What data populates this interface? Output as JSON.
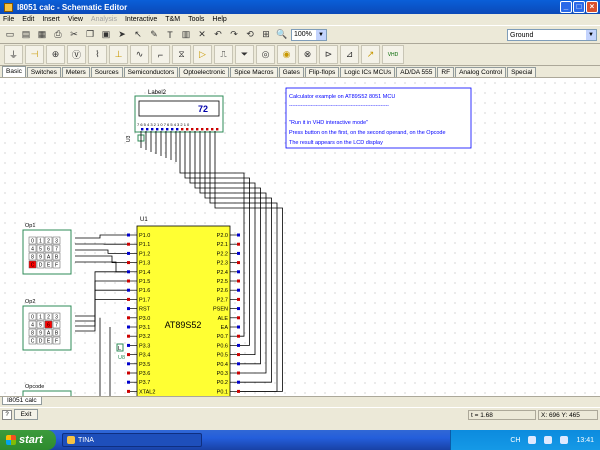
{
  "window": {
    "title": "I8051 calc - Schematic Editor",
    "minimize": "_",
    "maximize": "□",
    "close": "×"
  },
  "menu": [
    {
      "label": "File",
      "enabled": true
    },
    {
      "label": "Edit",
      "enabled": true
    },
    {
      "label": "Insert",
      "enabled": true
    },
    {
      "label": "View",
      "enabled": true
    },
    {
      "label": "Analysis",
      "enabled": false
    },
    {
      "label": "Interactive",
      "enabled": true
    },
    {
      "label": "T&M",
      "enabled": true
    },
    {
      "label": "Tools",
      "enabled": true
    },
    {
      "label": "Help",
      "enabled": true
    }
  ],
  "toolbar": {
    "zoom": "100%",
    "ground_select": "Ground",
    "dd_glyph": "▼"
  },
  "toolbar_icons": [
    "new-icon",
    "open-icon",
    "save-icon",
    "print-icon",
    "cut-icon",
    "copy-icon",
    "paste-icon",
    "pointer-icon",
    "arrow-icon",
    "pencil-icon",
    "text-icon",
    "bus-icon",
    "delete-icon",
    "undo-icon",
    "redo-icon",
    "rotate-icon",
    "grid-icon",
    "zoom-icon"
  ],
  "toolbar_icon_glyphs": [
    "▭",
    "▤",
    "▦",
    "⎙",
    "✂",
    "❐",
    "▣",
    "➤",
    "↖",
    "✎",
    "T",
    "▥",
    "✕",
    "↶",
    "↷",
    "⟲",
    "⊞",
    "🔍"
  ],
  "component_icons": [
    "ground-icon",
    "battery-icon",
    "dc-source-icon",
    "voltmeter-icon",
    "resistor-icon",
    "capacitor-icon",
    "inductor-icon",
    "switch-icon",
    "transformer-icon",
    "diode-icon",
    "npn-icon",
    "pnp-icon",
    "lamp-icon",
    "jumper-icon",
    "led-icon",
    "opamp-icon",
    "relay-icon",
    "probe-icon"
  ],
  "component_glyphs": [
    "⏚",
    "⊣",
    "⊕",
    "Ⓥ",
    "⌇",
    "⊥",
    "∿",
    "⌐",
    "⧖",
    "▷",
    "⎍",
    "⏷",
    "◎",
    "◉",
    "⊗",
    "⊳",
    "⊿",
    "↗"
  ],
  "vhd_label": "VHD",
  "tabs": [
    "Basic",
    "Switches",
    "Meters",
    "Sources",
    "Semiconductors",
    "Optoelectronic",
    "Spice Macros",
    "Gates",
    "Flip-flops",
    "Logic ICs MCUs",
    "AD/DA 555",
    "RF",
    "Analog Control",
    "Special"
  ],
  "active_tab": "Basic",
  "lcd": {
    "title": "Label2",
    "value": "72",
    "pins": "7 6 5 4 3 2 1 0 7 6 5 4 3 2 1 0",
    "designator": "U3"
  },
  "note": {
    "line1": "Calculator example on AT89S52 8051 MCU",
    "line2": "------------------------------------------------------------",
    "line3": "\"Run it in VHD interactive mode\"",
    "line4": "Press button on the first, on the second operand, on the Opcode",
    "line5": "The result appears on the LCD display"
  },
  "mcu": {
    "designator": "U1",
    "part": "AT89S52",
    "left_pins": [
      "P1.0",
      "P1.1",
      "P1.2",
      "P1.3",
      "P1.4",
      "P1.5",
      "P1.6",
      "P1.7",
      "RST",
      "P3.0",
      "P3.1",
      "P3.2",
      "P3.3",
      "P3.4",
      "P3.5",
      "P3.6",
      "P3.7",
      "XTAL2"
    ],
    "right_pins": [
      "P2.0",
      "P2.1",
      "P2.2",
      "P2.3",
      "P2.4",
      "P2.5",
      "P2.6",
      "P2.7",
      "PSEN",
      "ALE",
      "EA",
      "P0.7",
      "P0.6",
      "P0.5",
      "P0.4",
      "P0.3",
      "P0.2",
      "P0.1"
    ]
  },
  "keypads": [
    {
      "label": "Op1",
      "keys": [
        "0",
        "1",
        "2",
        "3",
        "4",
        "5",
        "6",
        "7",
        "8",
        "9",
        "A",
        "B",
        "C",
        "D",
        "E",
        "F"
      ],
      "pressed": "C"
    },
    {
      "label": "Op2",
      "keys": [
        "0",
        "1",
        "2",
        "3",
        "4",
        "5",
        "6",
        "7",
        "8",
        "9",
        "A",
        "B",
        "C",
        "D",
        "E",
        "F"
      ],
      "pressed": "6"
    },
    {
      "label": "Opcode"
    }
  ],
  "small_labels": {
    "l": "L",
    "u5": "U5",
    "u8": "U8"
  },
  "document_tab": "I8051 calc",
  "status": {
    "exit": "Exit",
    "time": "t = 1.68",
    "coords": "X: 696 Y: 465",
    "icon": "?"
  },
  "taskbar": {
    "start": "start",
    "task": "TINA",
    "lang": "CH",
    "clock": "13:41"
  },
  "colors": {
    "mcu_fill": "#ffff33",
    "wire": "#000000",
    "title_blue": "#0b49b8",
    "note_text": "#0000ff",
    "pressed_key": "#ff0000",
    "green_box": "#2e8b57"
  }
}
